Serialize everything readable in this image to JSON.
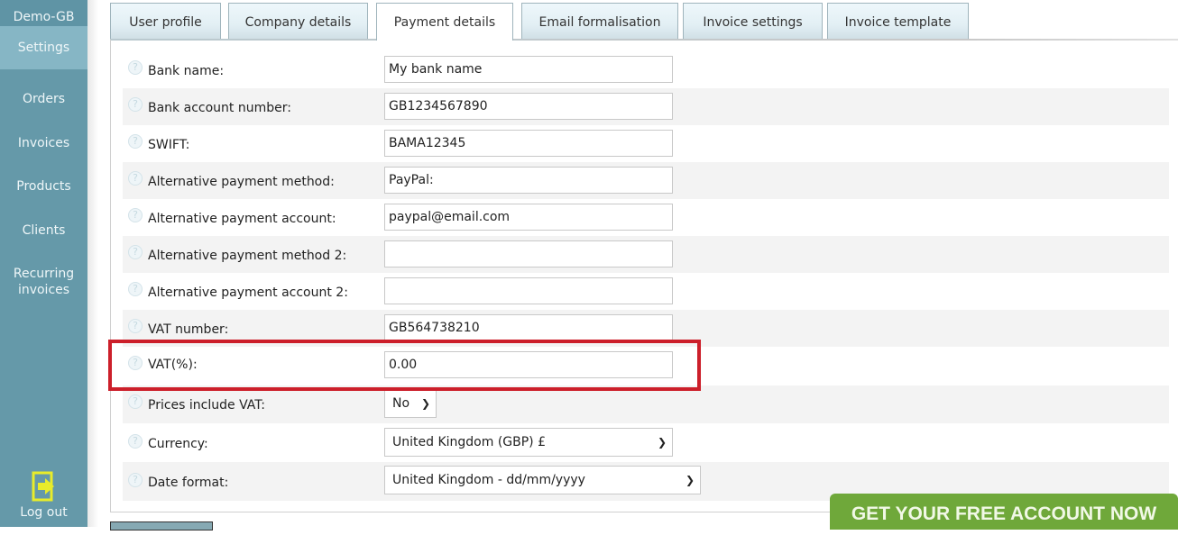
{
  "sidebar": {
    "account": "Demo-GB",
    "items": [
      {
        "label": "Settings",
        "active": true
      },
      {
        "label": "Orders"
      },
      {
        "label": "Invoices"
      },
      {
        "label": "Products"
      },
      {
        "label": "Clients"
      },
      {
        "label": "Recurring invoices"
      }
    ],
    "logout_label": "Log out",
    "logout_icon": "logout-icon"
  },
  "tabs": [
    {
      "label": "User profile"
    },
    {
      "label": "Company details"
    },
    {
      "label": "Payment details",
      "active": true
    },
    {
      "label": "Email formalisation"
    },
    {
      "label": "Invoice settings"
    },
    {
      "label": "Invoice template"
    }
  ],
  "form": {
    "help_icon": "help-icon",
    "fields": [
      {
        "label": "Bank name:",
        "value": "My bank name"
      },
      {
        "label": "Bank account number:",
        "value": "GB1234567890"
      },
      {
        "label": "SWIFT:",
        "value": "BAMA12345"
      },
      {
        "label": "Alternative payment method:",
        "value": "PayPal:"
      },
      {
        "label": "Alternative payment account:",
        "value": "paypal@email.com"
      },
      {
        "label": "Alternative payment method 2:",
        "value": ""
      },
      {
        "label": "Alternative payment account 2:",
        "value": ""
      },
      {
        "label": "VAT number:",
        "value": "GB564738210"
      },
      {
        "label": "VAT(%):",
        "value": "0.00"
      },
      {
        "label": "Prices include VAT:",
        "value": "No"
      },
      {
        "label": "Currency:",
        "value": "United Kingdom (GBP) £"
      },
      {
        "label": "Date format:",
        "value": "United Kingdom - dd/mm/yyyy"
      }
    ]
  },
  "cta": {
    "label": "GET YOUR FREE ACCOUNT NOW",
    "color": "#6fa83a"
  },
  "highlight_color": "#cc1f2a"
}
